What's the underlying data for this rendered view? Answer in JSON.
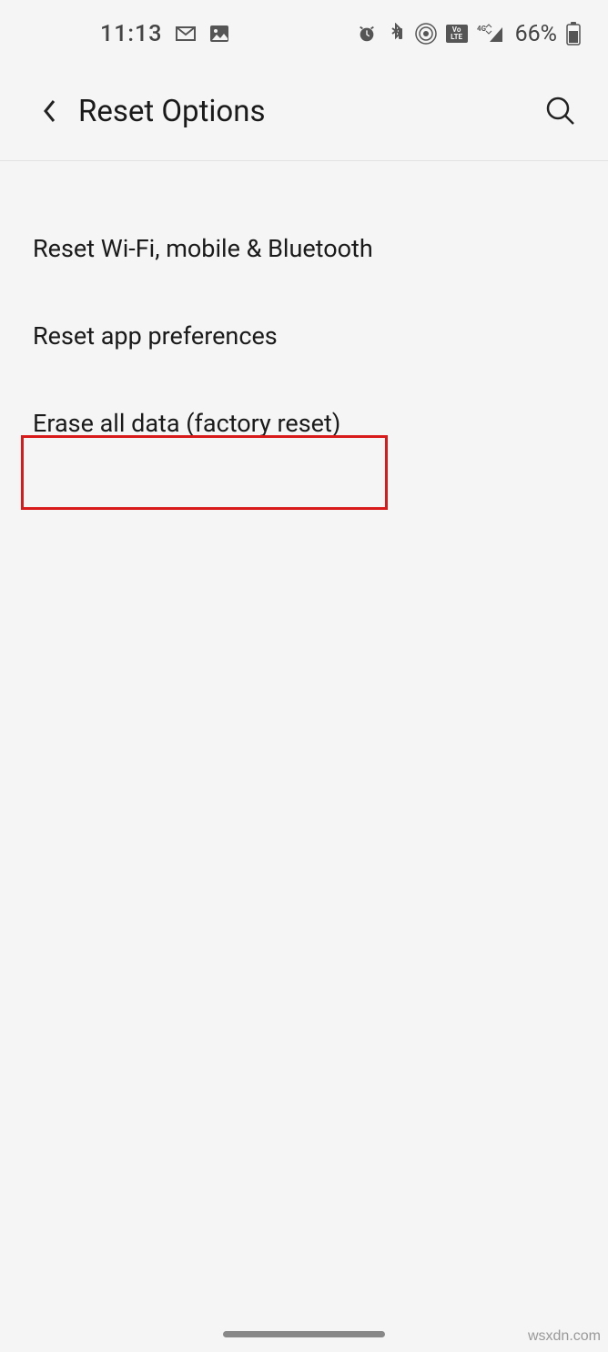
{
  "status_bar": {
    "time": "11:13",
    "battery_percent": "66%"
  },
  "header": {
    "title": "Reset Options"
  },
  "options": [
    {
      "label": "Reset Wi-Fi, mobile & Bluetooth"
    },
    {
      "label": "Reset app preferences"
    },
    {
      "label": "Erase all data (factory reset)"
    }
  ],
  "watermark": "wsxdn.com"
}
